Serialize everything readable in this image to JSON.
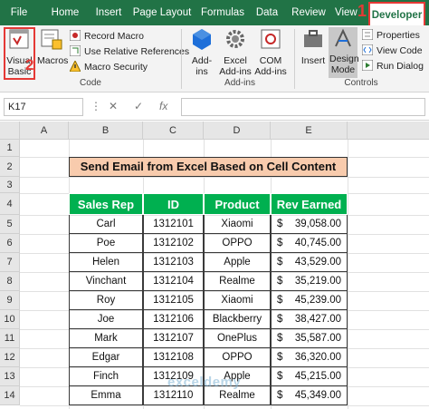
{
  "tabs": [
    {
      "label": "File"
    },
    {
      "label": "Home"
    },
    {
      "label": "Insert"
    },
    {
      "label": "Page Layout"
    },
    {
      "label": "Formulas"
    },
    {
      "label": "Data"
    },
    {
      "label": "Review"
    },
    {
      "label": "View"
    },
    {
      "label": "Developer"
    }
  ],
  "callouts": {
    "one": "1",
    "two": "2"
  },
  "ribbon": {
    "code": {
      "visual_basic": "Visual Basic",
      "macros": "Macros",
      "record_macro": "Record Macro",
      "relative_refs": "Use Relative References",
      "macro_security": "Macro Security",
      "group_label": "Code"
    },
    "addins": {
      "addins": "Add-ins",
      "excel_addins": "Excel Add-ins",
      "com_addins": "COM Add-ins",
      "group_label": "Add-ins"
    },
    "controls": {
      "insert": "Insert",
      "design_mode": "Design Mode",
      "properties": "Properties",
      "view_code": "View Code",
      "run_dialog": "Run Dialog",
      "group_label": "Controls"
    }
  },
  "formula_bar": {
    "name_box": "K17",
    "fx": "fx",
    "value": ""
  },
  "columns": [
    "A",
    "B",
    "C",
    "D",
    "E"
  ],
  "rows": [
    "1",
    "2",
    "3",
    "4",
    "5",
    "6",
    "7",
    "8",
    "9",
    "10",
    "11",
    "12",
    "13",
    "14"
  ],
  "sheet": {
    "title": "Send Email from Excel Based on Cell Content",
    "headers": [
      "Sales Rep",
      "ID",
      "Product",
      "Rev Earned"
    ],
    "records": [
      {
        "rep": "Carl",
        "id": "1312101",
        "product": "Xiaomi",
        "cur": "$",
        "amount": "39,058.00"
      },
      {
        "rep": "Poe",
        "id": "1312102",
        "product": "OPPO",
        "cur": "$",
        "amount": "40,745.00"
      },
      {
        "rep": "Helen",
        "id": "1312103",
        "product": "Apple",
        "cur": "$",
        "amount": "43,529.00"
      },
      {
        "rep": "Vinchant",
        "id": "1312104",
        "product": "Realme",
        "cur": "$",
        "amount": "35,219.00"
      },
      {
        "rep": "Roy",
        "id": "1312105",
        "product": "Xiaomi",
        "cur": "$",
        "amount": "45,239.00"
      },
      {
        "rep": "Joe",
        "id": "1312106",
        "product": "Blackberry",
        "cur": "$",
        "amount": "38,427.00"
      },
      {
        "rep": "Mark",
        "id": "1312107",
        "product": "OnePlus",
        "cur": "$",
        "amount": "35,587.00"
      },
      {
        "rep": "Edgar",
        "id": "1312108",
        "product": "OPPO",
        "cur": "$",
        "amount": "36,320.00"
      },
      {
        "rep": "Finch",
        "id": "1312109",
        "product": "Apple",
        "cur": "$",
        "amount": "45,215.00"
      },
      {
        "rep": "Emma",
        "id": "1312110",
        "product": "Realme",
        "cur": "$",
        "amount": "45,349.00"
      }
    ]
  },
  "watermark": "exceldemy",
  "colors": {
    "ribbon_green": "#217346",
    "header_green": "#00b050",
    "title_fill": "#f8cbad",
    "callout_red": "#e53935"
  }
}
